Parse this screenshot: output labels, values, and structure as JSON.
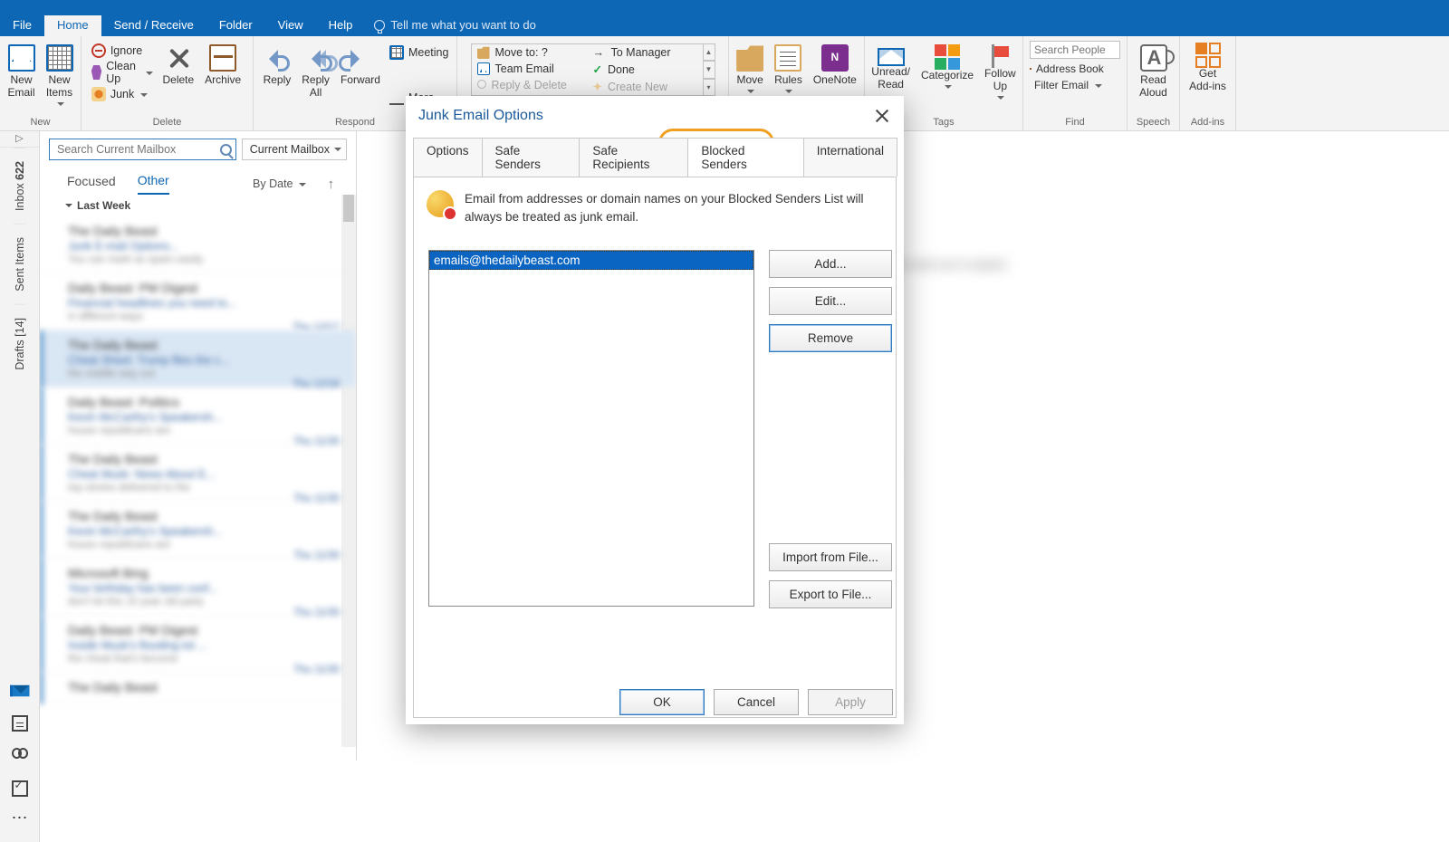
{
  "menubar": {
    "tabs": [
      "File",
      "Home",
      "Send / Receive",
      "Folder",
      "View",
      "Help"
    ],
    "active_index": 1,
    "tell_me": "Tell me what you want to do"
  },
  "ribbon": {
    "new_group": {
      "label": "New",
      "new_email": "New\nEmail",
      "new_items": "New\nItems"
    },
    "delete_group": {
      "label": "Delete",
      "ignore": "Ignore",
      "clean": "Clean Up",
      "junk": "Junk",
      "delete": "Delete",
      "archive": "Archive"
    },
    "respond_group": {
      "label": "Respond",
      "reply": "Reply",
      "reply_all": "Reply\nAll",
      "forward": "Forward",
      "meeting": "Meeting",
      "more": "More"
    },
    "quicksteps": {
      "move_to": "Move to: ?",
      "team_email": "Team Email",
      "reply_delete": "Reply & Delete",
      "to_manager": "To Manager",
      "done": "Done",
      "create_new": "Create New"
    },
    "move_group": {
      "label": "Move",
      "move": "Move",
      "rules": "Rules",
      "onenote": "OneNote"
    },
    "tags_group": {
      "label": "Tags",
      "unread": "Unread/\nRead",
      "categorize": "Categorize",
      "followup": "Follow\nUp"
    },
    "find_group": {
      "label": "Find",
      "search_placeholder": "Search People",
      "addr": "Address Book",
      "filter": "Filter Email"
    },
    "speech_group": {
      "label": "Speech",
      "btn": "Read\nAloud"
    },
    "addins_group": {
      "label": "Add-ins",
      "btn": "Get\nAdd-ins"
    }
  },
  "rail": {
    "inbox": "Inbox",
    "inbox_count": "622",
    "sent": "Sent Items",
    "drafts": "Drafts [14]"
  },
  "maillist": {
    "search_placeholder": "Search Current Mailbox",
    "scope": "Current Mailbox",
    "tabs": [
      "Focused",
      "Other"
    ],
    "active_tab": 1,
    "sort": "By Date",
    "group": "Last Week",
    "items": [
      {
        "from": "The Daily Beast",
        "subj": "Junk E-mail Options...",
        "prev": "You can mark as spam easily",
        "date": ""
      },
      {
        "from": "Daily Beast: PM Digest",
        "subj": "Financial headlines you need to...",
        "prev": "in different ways",
        "date": "Thu 12/17"
      },
      {
        "from": "The Daily Beast",
        "subj": "Cheat Sheet: Trump flies the c...",
        "prev": "the middle way out",
        "date": "Thu 12/16"
      },
      {
        "from": "Daily Beast: Politics",
        "subj": "Kevin McCarthy's Speakersh...",
        "prev": "house republicans are",
        "date": "Thu 11/30"
      },
      {
        "from": "The Daily Beast",
        "subj": "Cheat Musk: News About E...",
        "prev": "top stories delivered to the",
        "date": "Thu 11/30"
      },
      {
        "from": "The Daily Beast",
        "subj": "Kevin McCarthy's Speakersh...",
        "prev": "house republicans are",
        "date": "Thu 11/30"
      },
      {
        "from": "Microsoft Bing",
        "subj": "Your birthday has been conf...",
        "prev": "don't let this 10 year old party",
        "date": "Thu 11/30"
      },
      {
        "from": "Daily Beast: PM Digest",
        "subj": "Inside Musk's flooding tot ...",
        "prev": "the cheat that's become",
        "date": "Thu 11/30"
      },
      {
        "from": "The Daily Beast",
        "subj": "",
        "prev": "",
        "date": ""
      }
    ],
    "selected_index": 2
  },
  "dialog": {
    "title": "Junk Email Options",
    "tabs": [
      "Options",
      "Safe Senders",
      "Safe Recipients",
      "Blocked Senders",
      "International"
    ],
    "selected_tab": 3,
    "description": "Email from addresses or domain names on your Blocked Senders List will always be treated as junk email.",
    "list": [
      "emails@thedailybeast.com"
    ],
    "selected_item": 0,
    "buttons": {
      "add": "Add...",
      "edit": "Edit...",
      "remove": "Remove",
      "import": "Import from File...",
      "export": "Export to File..."
    },
    "footer": {
      "ok": "OK",
      "cancel": "Cancel",
      "apply": "Apply"
    }
  }
}
